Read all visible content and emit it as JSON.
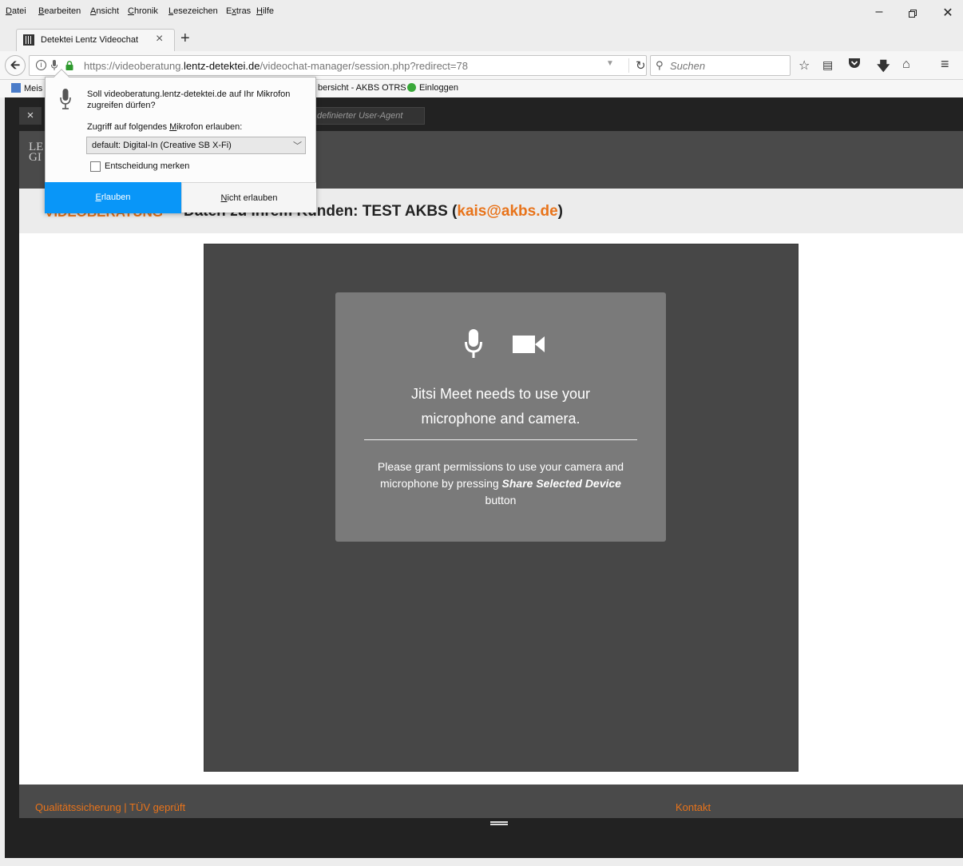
{
  "menubar": {
    "items": [
      "Datei",
      "Bearbeiten",
      "Ansicht",
      "Chronik",
      "Lesezeichen",
      "Extras",
      "Hilfe"
    ]
  },
  "window_controls": [
    "minimize-icon",
    "restore-icon",
    "close-icon"
  ],
  "tab": {
    "title": "Detektei Lentz Videochat",
    "close": "×",
    "new_tab": "+"
  },
  "urlbar": {
    "prefix": "https://videoberatung.",
    "domain": "lentz-detektei.de",
    "path": "/videochat-manager/session.php?redirect=78"
  },
  "searchbar": {
    "placeholder": "Suchen"
  },
  "toolbar_icons": [
    "bookmark-star-icon",
    "reader-list-icon",
    "pocket-icon",
    "download-icon",
    "home-icon",
    "menu-icon"
  ],
  "bookmarks": {
    "items": [
      "Meis",
      "bersicht - AKBS OTRS",
      "Einloggen"
    ]
  },
  "responsive_toolbar": {
    "close": "×",
    "user_agent_placeholder": "definierter User-Agent"
  },
  "page": {
    "subheader_left": "VIDEOBERATUNG",
    "subheader_title": "Daten zu Ihrem Kunden: TEST AKBS (",
    "subheader_email": "kais@akbs.de",
    "subheader_close": ")",
    "footer_left": "Qualitätssicherung | TÜV geprüft",
    "footer_right": "Kontakt",
    "logo_text": "LE GI"
  },
  "permission_overlay": {
    "heading_line1": "Jitsi Meet needs to use your",
    "heading_line2": "microphone and camera.",
    "desc_part1": "Please grant permissions to use your camera and microphone by pressing",
    "desc_bold": "Share Selected Device",
    "desc_part2": "button"
  },
  "popup": {
    "question": "Soll videoberatung.lentz-detektei.de auf Ihr Mikrofon zugreifen dürfen?",
    "access_label_pre": "Zugriff auf folgendes ",
    "access_label_u": "M",
    "access_label_post": "ikrofon erlauben:",
    "select_value": "default: Digital-In (Creative SB X-Fi)",
    "checkbox_label": "Entscheidung merken",
    "allow_u": "E",
    "allow_rest": "rlauben",
    "deny_u": "N",
    "deny_rest": "icht erlauben"
  },
  "colors": {
    "accent_orange": "#e8731a",
    "allow_blue": "#0996f8"
  }
}
